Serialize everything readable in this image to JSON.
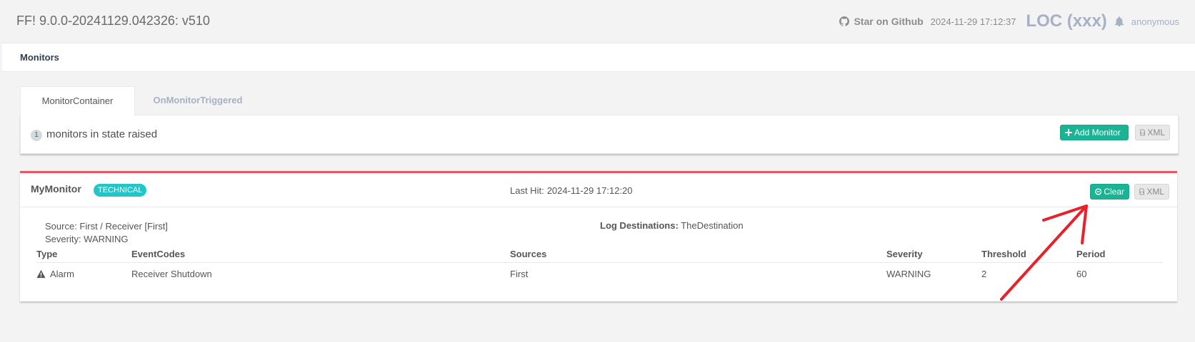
{
  "header": {
    "app_title": "FF! 9.0.0-20241129.042326: v510",
    "github_label": "Star on Github",
    "timestamp": "2024-11-29 17:12:37",
    "location": "LOC (xxx)",
    "user": "anonymous"
  },
  "breadcrumb": {
    "title": "Monitors"
  },
  "tabs": [
    {
      "label": "MonitorContainer",
      "active": true
    },
    {
      "label": "OnMonitorTriggered",
      "active": false
    }
  ],
  "summary": {
    "count": "1",
    "text": "monitors in state raised",
    "add_button": "Add Monitor",
    "xml_button": "XML"
  },
  "monitor": {
    "name": "MyMonitor",
    "type_label": "TECHNICAL",
    "last_hit_label": "Last Hit:",
    "last_hit_value": "2024-11-29 17:12:20",
    "clear_button": "Clear",
    "xml_button": "XML",
    "source": "Source: First / Receiver [First]",
    "severity": "Severity: WARNING",
    "log_dest_label": "Log Destinations:",
    "log_dest_value": "TheDestination",
    "table": {
      "headers": [
        "Type",
        "EventCodes",
        "Sources",
        "Severity",
        "Threshold",
        "Period"
      ],
      "rows": [
        {
          "type": "Alarm",
          "event_codes": "Receiver Shutdown",
          "sources": "First",
          "severity": "WARNING",
          "threshold": "2",
          "period": "60"
        }
      ]
    }
  },
  "colors": {
    "accent": "#1ab394",
    "alert_border": "#ed5565",
    "label_info": "#23c6c8",
    "annotation_arrow": "#e8202a"
  }
}
